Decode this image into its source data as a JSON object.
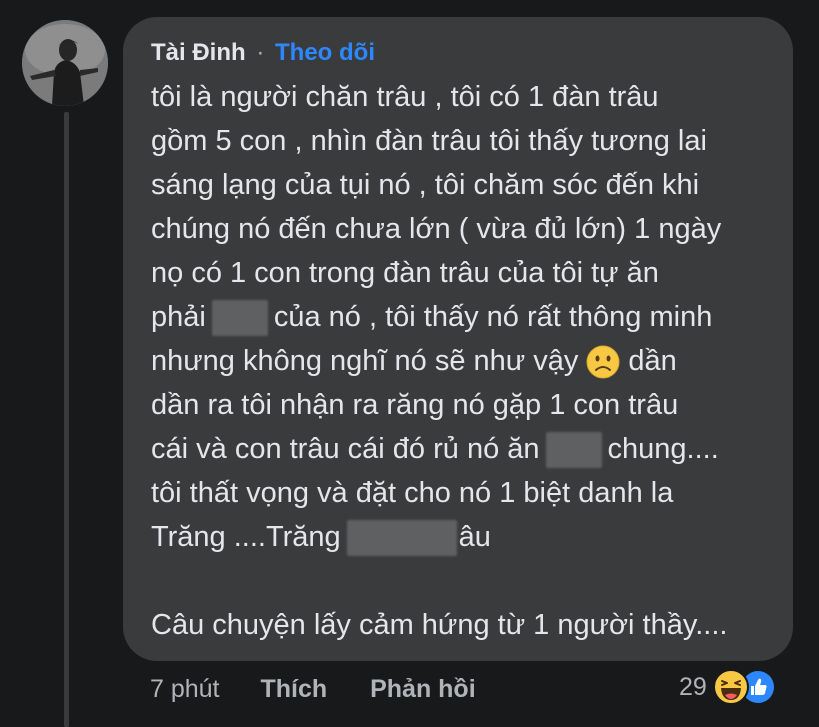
{
  "comment": {
    "author": "Tài Đinh",
    "separator": "·",
    "follow_label": "Theo dõi",
    "lines": [
      "tôi là người chăn trâu , tôi có 1 đàn trâu",
      "gồm 5 con , nhìn đàn trâu tôi thấy tương lai",
      "sáng lạng của tụi nó , tôi chăm sóc đến khi",
      "chúng nó đến chưa lớn ( vừa đủ lớn) 1 ngày",
      "nọ có 1 con trong đàn trâu của tôi tự ăn"
    ],
    "line6_before": "phải",
    "line6_after": "của nó , tôi thấy nó rất thông minh",
    "line7_before": "nhưng không nghĩ nó sẽ như vậy",
    "line7_after": "dần",
    "line8": "dần ra tôi nhận ra răng nó gặp 1 con trâu",
    "line9_before": "cái và con trâu cái đó rủ nó ăn",
    "line9_after": "chung....",
    "line10": "tôi thất vọng và đặt cho nó 1 biệt danh la",
    "line11_before": "Trăng ....Trăng",
    "line11_after": "âu",
    "line_final": "Câu chuyện lấy cảm hứng từ 1 người thầy....",
    "inline_emoji": "slightly-frowning-face-icon"
  },
  "actions": {
    "time": "7 phút",
    "like_label": "Thích",
    "reply_label": "Phản hồi"
  },
  "reactions": {
    "count": "29",
    "icons": [
      "haha-reaction-icon",
      "like-reaction-icon"
    ]
  },
  "colors": {
    "background": "#18191a",
    "bubble": "#3a3b3c",
    "text": "#e4e6eb",
    "secondary_text": "#b0b3b8",
    "link_blue": "#2d88ff"
  }
}
